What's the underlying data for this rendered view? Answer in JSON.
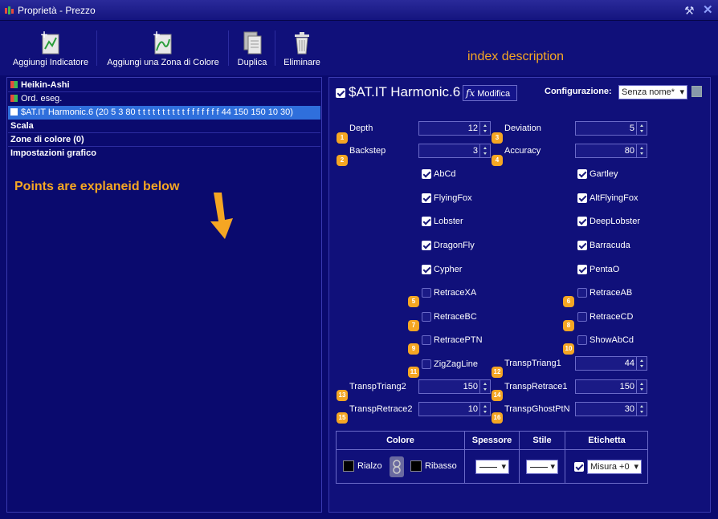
{
  "window": {
    "title": "Proprietà - Prezzo"
  },
  "toolbar": {
    "add_indicator": "Aggiungi Indicatore",
    "add_color_zone": "Aggiungi una Zona di Colore",
    "duplicate": "Duplica",
    "delete": "Eliminare"
  },
  "annotations": {
    "index_description": "index description",
    "points_note": "Points are explaneid below"
  },
  "tree": {
    "items": [
      {
        "label": "Heikin-Ashi",
        "bold": true,
        "color": "#3cba54"
      },
      {
        "label": "Ord. eseg.",
        "bold": false,
        "color": "#3cba54"
      },
      {
        "label": "$AT.IT Harmonic.6 (20 5 3 80 t t t t t t t t t t f f f f f f f 44 150 150 10 30)",
        "bold": false,
        "selected": true,
        "color": "#ffffff"
      },
      {
        "label": "Scala",
        "bold": true
      },
      {
        "label": "Zone di colore (0)",
        "bold": true
      },
      {
        "label": "Impostazioni grafico",
        "bold": true
      }
    ]
  },
  "indicator": {
    "title": "$AT.IT Harmonic.6",
    "edit_label": "Modifica",
    "config_label": "Configurazione:",
    "config_value": "Senza nome*"
  },
  "params": {
    "depth": {
      "label": "Depth",
      "value": "12",
      "badge": "1"
    },
    "backstep": {
      "label": "Backstep",
      "value": "3",
      "badge": "2"
    },
    "deviation": {
      "label": "Deviation",
      "value": "5",
      "badge": "3"
    },
    "accuracy": {
      "label": "Accuracy",
      "value": "80",
      "badge": "4"
    },
    "transp_triang1": {
      "label": "TranspTriang1",
      "value": "44",
      "badge": "12"
    },
    "transp_triang2": {
      "label": "TranspTriang2",
      "value": "150",
      "badge": "13"
    },
    "transp_retrace1": {
      "label": "TranspRetrace1",
      "value": "150",
      "badge": "14"
    },
    "transp_retrace2": {
      "label": "TranspRetrace2",
      "value": "10",
      "badge": "15"
    },
    "transp_ghost": {
      "label": "TranspGhostPtN",
      "value": "30",
      "badge": "16"
    }
  },
  "checks_left": [
    {
      "label": "AbCd",
      "checked": true
    },
    {
      "label": "FlyingFox",
      "checked": true
    },
    {
      "label": "Lobster",
      "checked": true
    },
    {
      "label": "DragonFly",
      "checked": true
    },
    {
      "label": "Cypher",
      "checked": true
    },
    {
      "label": "RetraceXA",
      "checked": false,
      "badge": "5"
    },
    {
      "label": "RetraceBC",
      "checked": false,
      "badge": "7"
    },
    {
      "label": "RetracePTN",
      "checked": false,
      "badge": "9"
    },
    {
      "label": "ZigZagLine",
      "checked": false,
      "badge": "11"
    }
  ],
  "checks_right": [
    {
      "label": "Gartley",
      "checked": true
    },
    {
      "label": "AltFlyingFox",
      "checked": true
    },
    {
      "label": "DeepLobster",
      "checked": true
    },
    {
      "label": "Barracuda",
      "checked": true
    },
    {
      "label": "PentaO",
      "checked": true
    },
    {
      "label": "RetraceAB",
      "checked": false,
      "badge": "6"
    },
    {
      "label": "RetraceCD",
      "checked": false,
      "badge": "8"
    },
    {
      "label": "ShowAbCd",
      "checked": false,
      "badge": "10"
    }
  ],
  "style_table": {
    "headers": [
      "Colore",
      "Spessore",
      "Stile",
      "Etichetta"
    ],
    "rise_label": "Rialzo",
    "fall_label": "Ribasso",
    "label_value": "Misura +0"
  },
  "colors": {
    "accent": "#f5a623",
    "selected_row": "#2f6fdc",
    "background": "#0a0a6e"
  }
}
